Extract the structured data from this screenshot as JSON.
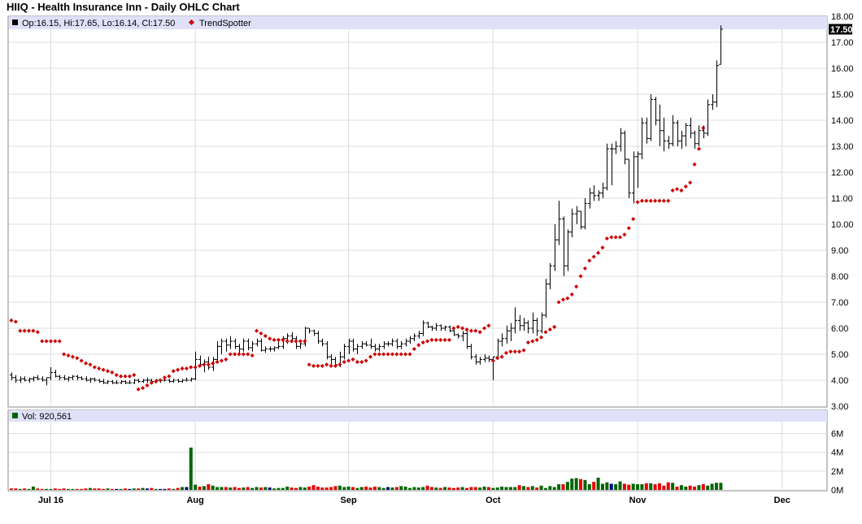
{
  "chart_data": [
    {
      "type": "ohlc",
      "title": "HIIQ - Health Insurance Inn - Daily OHLC Chart",
      "legend": {
        "ohlc_label": "Op:16.15, Hi:17.65, Lo:16.14, Cl:17.50",
        "trend_label": "TrendSpotter"
      },
      "last_price_label": "17.50",
      "ylim": [
        3,
        18
      ],
      "yticks": [
        "3.00",
        "4.00",
        "5.00",
        "6.00",
        "7.00",
        "8.00",
        "9.00",
        "10.00",
        "11.00",
        "12.00",
        "13.00",
        "14.00",
        "15.00",
        "16.00",
        "17.00",
        "18.00"
      ],
      "x_date_labels": [
        "Jul 16",
        "Aug",
        "Sep",
        "Oct",
        "Nov",
        "Dec"
      ],
      "x_date_label_index": [
        9,
        42,
        77,
        110,
        143,
        176
      ],
      "ohlc": [
        [
          4.2,
          4.3,
          4.0,
          4.1
        ],
        [
          4.1,
          4.2,
          3.9,
          4.0
        ],
        [
          4.0,
          4.15,
          3.9,
          4.05
        ],
        [
          4.05,
          4.15,
          3.95,
          4.0
        ],
        [
          4.0,
          4.1,
          3.9,
          4.05
        ],
        [
          4.05,
          4.15,
          3.95,
          4.1
        ],
        [
          4.1,
          4.2,
          4.0,
          4.05
        ],
        [
          4.05,
          4.15,
          3.95,
          4.0
        ],
        [
          4.0,
          4.1,
          3.8,
          4.1
        ],
        [
          4.1,
          4.5,
          4.0,
          4.3
        ],
        [
          4.3,
          4.4,
          4.1,
          4.15
        ],
        [
          4.15,
          4.2,
          4.0,
          4.1
        ],
        [
          4.1,
          4.2,
          4.0,
          4.05
        ],
        [
          4.05,
          4.15,
          3.95,
          4.1
        ],
        [
          4.1,
          4.2,
          4.0,
          4.15
        ],
        [
          4.15,
          4.2,
          4.0,
          4.1
        ],
        [
          4.1,
          4.15,
          4.0,
          4.05
        ],
        [
          4.05,
          4.15,
          3.95,
          4.0
        ],
        [
          4.0,
          4.1,
          3.9,
          4.05
        ],
        [
          4.05,
          4.1,
          3.95,
          4.0
        ],
        [
          4.0,
          4.05,
          3.9,
          3.95
        ],
        [
          3.95,
          4.05,
          3.85,
          3.9
        ],
        [
          3.9,
          4.0,
          3.85,
          3.95
        ],
        [
          3.95,
          4.0,
          3.85,
          3.9
        ],
        [
          3.9,
          4.0,
          3.85,
          3.9
        ],
        [
          3.9,
          4.0,
          3.85,
          3.95
        ],
        [
          3.95,
          4.0,
          3.85,
          3.9
        ],
        [
          3.9,
          4.0,
          3.85,
          3.9
        ],
        [
          3.9,
          4.05,
          3.85,
          4.0
        ],
        [
          4.0,
          4.05,
          3.9,
          3.95
        ],
        [
          3.95,
          4.05,
          3.9,
          4.0
        ],
        [
          4.0,
          4.1,
          3.9,
          4.0
        ],
        [
          4.0,
          4.05,
          3.9,
          3.95
        ],
        [
          3.95,
          4.05,
          3.9,
          4.0
        ],
        [
          4.0,
          4.05,
          3.9,
          4.0
        ],
        [
          4.0,
          4.1,
          3.95,
          4.0
        ],
        [
          4.0,
          4.05,
          3.9,
          3.95
        ],
        [
          3.95,
          4.05,
          3.9,
          4.0
        ],
        [
          4.0,
          4.05,
          3.9,
          3.95
        ],
        [
          3.95,
          4.05,
          3.9,
          4.0
        ],
        [
          4.0,
          4.1,
          3.95,
          4.0
        ],
        [
          4.0,
          4.1,
          3.95,
          4.05
        ],
        [
          4.05,
          5.1,
          4.0,
          4.8
        ],
        [
          4.8,
          4.95,
          4.5,
          4.6
        ],
        [
          4.6,
          4.8,
          4.3,
          4.7
        ],
        [
          4.7,
          4.9,
          4.4,
          4.5
        ],
        [
          4.5,
          4.9,
          4.35,
          4.8
        ],
        [
          4.8,
          5.5,
          4.7,
          5.3
        ],
        [
          5.3,
          5.6,
          5.0,
          5.5
        ],
        [
          5.5,
          5.6,
          5.1,
          5.35
        ],
        [
          5.35,
          5.7,
          5.2,
          5.5
        ],
        [
          5.5,
          5.6,
          5.2,
          5.3
        ],
        [
          5.3,
          5.4,
          5.0,
          5.2
        ],
        [
          5.2,
          5.6,
          5.1,
          5.5
        ],
        [
          5.5,
          5.6,
          5.15,
          5.25
        ],
        [
          5.25,
          5.5,
          5.1,
          5.4
        ],
        [
          5.4,
          5.6,
          5.3,
          5.5
        ],
        [
          5.5,
          5.6,
          5.1,
          5.15
        ],
        [
          5.15,
          5.3,
          5.05,
          5.2
        ],
        [
          5.2,
          5.3,
          5.1,
          5.2
        ],
        [
          5.2,
          5.3,
          5.1,
          5.25
        ],
        [
          5.25,
          5.5,
          5.2,
          5.3
        ],
        [
          5.3,
          5.7,
          5.2,
          5.6
        ],
        [
          5.6,
          5.8,
          5.4,
          5.7
        ],
        [
          5.7,
          5.85,
          5.5,
          5.6
        ],
        [
          5.6,
          5.7,
          5.2,
          5.3
        ],
        [
          5.3,
          5.5,
          5.2,
          5.4
        ],
        [
          5.4,
          6.05,
          5.3,
          6.0
        ],
        [
          6.0,
          6.0,
          5.8,
          5.9
        ],
        [
          5.9,
          5.95,
          5.7,
          5.8
        ],
        [
          5.8,
          5.9,
          5.4,
          5.5
        ],
        [
          5.5,
          5.6,
          5.3,
          5.4
        ],
        [
          5.4,
          5.5,
          4.8,
          4.9
        ],
        [
          4.9,
          5.0,
          4.6,
          4.8
        ],
        [
          4.8,
          4.9,
          4.5,
          4.6
        ],
        [
          4.6,
          5.1,
          4.5,
          4.9
        ],
        [
          4.9,
          5.4,
          4.8,
          5.3
        ],
        [
          5.3,
          5.6,
          5.0,
          5.5
        ],
        [
          5.5,
          5.6,
          5.1,
          5.2
        ],
        [
          5.2,
          5.4,
          5.0,
          5.3
        ],
        [
          5.3,
          5.5,
          5.2,
          5.4
        ],
        [
          5.4,
          5.5,
          5.3,
          5.35
        ],
        [
          5.35,
          5.6,
          5.2,
          5.3
        ],
        [
          5.3,
          5.4,
          5.1,
          5.2
        ],
        [
          5.2,
          5.4,
          5.1,
          5.3
        ],
        [
          5.3,
          5.5,
          5.2,
          5.4
        ],
        [
          5.4,
          5.5,
          5.3,
          5.4
        ],
        [
          5.4,
          5.6,
          5.3,
          5.5
        ],
        [
          5.5,
          5.6,
          5.2,
          5.3
        ],
        [
          5.3,
          5.5,
          5.2,
          5.4
        ],
        [
          5.4,
          5.6,
          5.3,
          5.5
        ],
        [
          5.5,
          5.7,
          5.4,
          5.6
        ],
        [
          5.6,
          5.8,
          5.5,
          5.7
        ],
        [
          5.7,
          5.9,
          5.6,
          5.8
        ],
        [
          5.8,
          6.3,
          5.7,
          6.2
        ],
        [
          6.2,
          6.25,
          6.0,
          6.05
        ],
        [
          6.05,
          6.1,
          5.9,
          6.0
        ],
        [
          6.0,
          6.2,
          5.9,
          6.1
        ],
        [
          6.1,
          6.15,
          5.9,
          6.0
        ],
        [
          6.0,
          6.1,
          5.9,
          6.05
        ],
        [
          6.05,
          6.1,
          5.85,
          5.9
        ],
        [
          5.9,
          5.95,
          5.7,
          5.75
        ],
        [
          5.75,
          5.8,
          5.6,
          5.7
        ],
        [
          5.7,
          5.9,
          5.5,
          5.8
        ],
        [
          5.8,
          5.9,
          5.2,
          5.3
        ],
        [
          5.3,
          5.4,
          4.8,
          4.9
        ],
        [
          4.9,
          5.0,
          4.6,
          4.7
        ],
        [
          4.7,
          4.9,
          4.6,
          4.8
        ],
        [
          4.8,
          5.0,
          4.7,
          4.85
        ],
        [
          4.85,
          4.95,
          4.7,
          4.8
        ],
        [
          4.8,
          4.9,
          4.0,
          4.9
        ],
        [
          4.9,
          5.6,
          4.8,
          5.5
        ],
        [
          5.5,
          5.8,
          5.3,
          5.6
        ],
        [
          5.6,
          6.1,
          5.4,
          5.9
        ],
        [
          5.9,
          6.2,
          5.5,
          6.0
        ],
        [
          6.0,
          6.8,
          5.8,
          6.3
        ],
        [
          6.3,
          6.5,
          5.9,
          6.1
        ],
        [
          6.1,
          6.4,
          5.9,
          6.2
        ],
        [
          6.2,
          6.3,
          5.8,
          6.0
        ],
        [
          6.0,
          6.6,
          5.8,
          6.3
        ],
        [
          6.3,
          6.4,
          5.7,
          5.9
        ],
        [
          5.9,
          6.6,
          5.8,
          6.5
        ],
        [
          6.5,
          7.9,
          6.4,
          7.7
        ],
        [
          7.7,
          8.5,
          7.5,
          8.4
        ],
        [
          8.4,
          10.0,
          8.2,
          9.4
        ],
        [
          9.4,
          10.9,
          9.2,
          10.2
        ],
        [
          10.2,
          10.3,
          8.0,
          8.4
        ],
        [
          8.4,
          9.8,
          8.2,
          9.7
        ],
        [
          9.7,
          10.6,
          9.5,
          10.4
        ],
        [
          10.4,
          10.7,
          10.0,
          10.5
        ],
        [
          10.5,
          10.5,
          9.8,
          9.9
        ],
        [
          9.9,
          11.0,
          9.8,
          10.8
        ],
        [
          10.8,
          11.4,
          10.6,
          11.2
        ],
        [
          11.2,
          11.5,
          10.9,
          11.1
        ],
        [
          11.1,
          11.3,
          10.9,
          11.2
        ],
        [
          11.2,
          11.6,
          11.0,
          11.4
        ],
        [
          11.4,
          13.1,
          11.3,
          12.9
        ],
        [
          12.9,
          13.1,
          11.5,
          12.9
        ],
        [
          12.9,
          13.2,
          12.7,
          13.0
        ],
        [
          13.0,
          13.7,
          12.8,
          13.5
        ],
        [
          13.5,
          13.6,
          12.3,
          12.5
        ],
        [
          12.5,
          12.5,
          11.0,
          11.2
        ],
        [
          11.2,
          12.8,
          10.8,
          12.6
        ],
        [
          12.6,
          12.8,
          11.4,
          12.7
        ],
        [
          12.7,
          14.1,
          12.5,
          13.9
        ],
        [
          13.9,
          14.1,
          13.1,
          13.3
        ],
        [
          13.3,
          15.0,
          13.2,
          14.8
        ],
        [
          14.8,
          14.9,
          13.8,
          14.0
        ],
        [
          14.0,
          14.6,
          13.0,
          13.6
        ],
        [
          13.6,
          14.1,
          12.8,
          13.2
        ],
        [
          13.2,
          13.4,
          12.9,
          13.1
        ],
        [
          13.1,
          14.2,
          13.0,
          13.9
        ],
        [
          13.9,
          14.0,
          13.0,
          13.2
        ],
        [
          13.2,
          13.6,
          12.9,
          13.4
        ],
        [
          13.4,
          13.9,
          13.0,
          13.8
        ],
        [
          13.8,
          14.1,
          13.3,
          13.5
        ],
        [
          13.5,
          13.6,
          12.9,
          13.1
        ],
        [
          13.1,
          13.8,
          13.0,
          13.6
        ],
        [
          13.6,
          13.8,
          13.3,
          13.5
        ],
        [
          13.5,
          14.8,
          13.4,
          14.6
        ],
        [
          14.6,
          15.0,
          14.4,
          14.7
        ],
        [
          14.7,
          16.3,
          14.5,
          16.1
        ],
        [
          16.15,
          17.65,
          16.14,
          17.5
        ]
      ],
      "trendspotter": [
        6.3,
        6.25,
        5.9,
        5.9,
        5.9,
        5.9,
        5.85,
        5.5,
        5.5,
        5.5,
        5.5,
        5.5,
        5.0,
        4.95,
        4.9,
        4.85,
        4.75,
        4.65,
        4.6,
        4.5,
        4.45,
        4.4,
        4.35,
        4.3,
        4.2,
        4.15,
        4.15,
        4.15,
        4.2,
        3.65,
        3.7,
        3.8,
        3.9,
        3.95,
        4.0,
        4.1,
        4.15,
        4.35,
        4.4,
        4.45,
        4.45,
        4.5,
        4.5,
        4.55,
        4.6,
        4.6,
        4.65,
        4.7,
        4.75,
        4.8,
        5.0,
        5.0,
        5.0,
        5.0,
        5.0,
        4.95,
        5.9,
        5.8,
        5.7,
        5.6,
        5.55,
        5.55,
        5.55,
        5.5,
        5.5,
        5.5,
        5.5,
        5.5,
        4.6,
        4.55,
        4.55,
        4.55,
        4.6,
        4.55,
        4.55,
        4.6,
        4.7,
        4.75,
        4.8,
        4.7,
        4.7,
        4.75,
        4.9,
        5.0,
        5.0,
        5.0,
        5.0,
        5.0,
        5.0,
        5.0,
        5.0,
        5.0,
        5.2,
        5.35,
        5.45,
        5.5,
        5.55,
        5.55,
        5.55,
        5.55,
        5.55,
        6.0,
        6.05,
        6.0,
        5.95,
        5.9,
        5.9,
        5.85,
        6.0,
        6.1,
        4.75,
        4.85,
        4.9,
        5.05,
        5.1,
        5.1,
        5.1,
        5.15,
        5.45,
        5.5,
        5.55,
        5.65,
        5.85,
        5.95,
        6.05,
        7.0,
        7.1,
        7.15,
        7.3,
        7.6,
        8.0,
        8.3,
        8.6,
        8.75,
        8.9,
        9.1,
        9.45,
        9.5,
        9.5,
        9.5,
        9.6,
        9.85,
        10.2,
        10.85,
        10.9,
        10.9,
        10.9,
        10.9,
        10.9,
        10.9,
        10.9,
        11.3,
        11.35,
        11.3,
        11.45,
        11.6,
        12.3,
        12.9,
        13.7
      ],
      "ohlc_color": "#000000",
      "trend_color": "#cc0000"
    },
    {
      "type": "bar",
      "legend_label": "Vol: 920,561",
      "ylim": [
        0,
        7
      ],
      "yticks": [
        "0M",
        "2M",
        "4M",
        "6M"
      ],
      "unit": "millions",
      "values": [
        0.15,
        0.15,
        0.1,
        0.15,
        0.1,
        0.35,
        0.15,
        0.1,
        0.1,
        0.1,
        0.15,
        0.1,
        0.15,
        0.1,
        0.1,
        0.1,
        0.1,
        0.15,
        0.2,
        0.15,
        0.15,
        0.1,
        0.15,
        0.1,
        0.1,
        0.1,
        0.15,
        0.1,
        0.15,
        0.15,
        0.2,
        0.15,
        0.2,
        0.1,
        0.1,
        0.1,
        0.15,
        0.1,
        0.2,
        0.3,
        0.3,
        4.5,
        0.55,
        0.35,
        0.4,
        0.6,
        0.45,
        0.3,
        0.3,
        0.3,
        0.25,
        0.3,
        0.2,
        0.25,
        0.3,
        0.2,
        0.3,
        0.25,
        0.3,
        0.25,
        0.15,
        0.2,
        0.2,
        0.35,
        0.25,
        0.2,
        0.3,
        0.25,
        0.35,
        0.5,
        0.35,
        0.25,
        0.25,
        0.3,
        0.4,
        0.45,
        0.3,
        0.35,
        0.3,
        0.2,
        0.3,
        0.35,
        0.25,
        0.35,
        0.3,
        0.2,
        0.3,
        0.25,
        0.3,
        0.4,
        0.35,
        0.2,
        0.3,
        0.25,
        0.3,
        0.45,
        0.3,
        0.25,
        0.2,
        0.3,
        0.25,
        0.2,
        0.25,
        0.3,
        0.2,
        0.3,
        0.3,
        0.25,
        0.35,
        0.3,
        0.2,
        0.25,
        0.35,
        0.3,
        0.3,
        0.3,
        0.5,
        0.4,
        0.3,
        0.4,
        0.25,
        0.45,
        0.2,
        0.4,
        0.3,
        0.6,
        0.6,
        0.85,
        1.2,
        1.25,
        1.15,
        1.05,
        0.6,
        0.85,
        1.3,
        0.65,
        0.8,
        0.65,
        0.6,
        0.9,
        0.65,
        0.55,
        0.65,
        0.6,
        0.6,
        0.7,
        0.7,
        0.6,
        0.7,
        0.45,
        0.8,
        0.75,
        0.35,
        0.5,
        0.35,
        0.45,
        0.35,
        0.5,
        0.6,
        0.45,
        0.65,
        0.75,
        0.75
      ],
      "up_color": "#006600",
      "down_color": "#e60000",
      "neutral_color": "#000080"
    }
  ]
}
